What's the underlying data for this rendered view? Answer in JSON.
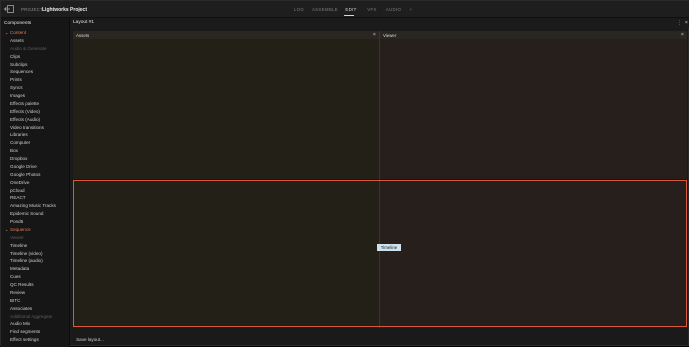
{
  "topbar": {
    "back_icon": "exit-icon",
    "project_label": "PROJECT",
    "project_name": "Lightworks Project",
    "tabs": [
      {
        "label": "LOG",
        "active": false
      },
      {
        "label": "ASSEMBLE",
        "active": false
      },
      {
        "label": "EDIT",
        "active": true
      },
      {
        "label": "VFX",
        "active": false
      },
      {
        "label": "AUDIO",
        "active": false
      },
      {
        "label": "+",
        "active": false
      }
    ]
  },
  "sidebar": {
    "title": "Components",
    "items": [
      {
        "label": "Content",
        "type": "group"
      },
      {
        "label": "Assets",
        "type": "item"
      },
      {
        "label": "Audio & Generate",
        "type": "dim"
      },
      {
        "label": "Clips",
        "type": "item"
      },
      {
        "label": "Subclips",
        "type": "item"
      },
      {
        "label": "Sequences",
        "type": "item"
      },
      {
        "label": "Prints",
        "type": "item"
      },
      {
        "label": "Syncs",
        "type": "item"
      },
      {
        "label": "Images",
        "type": "item"
      },
      {
        "label": "Effects palette",
        "type": "item"
      },
      {
        "label": "Effects (Video)",
        "type": "item"
      },
      {
        "label": "Effects (Audio)",
        "type": "item"
      },
      {
        "label": "Video transitions",
        "type": "item"
      },
      {
        "label": "Libraries",
        "type": "item"
      },
      {
        "label": "Computer",
        "type": "item"
      },
      {
        "label": "Box",
        "type": "item"
      },
      {
        "label": "Dropbox",
        "type": "item"
      },
      {
        "label": "Google Drive",
        "type": "item"
      },
      {
        "label": "Google Photos",
        "type": "item"
      },
      {
        "label": "OneDrive",
        "type": "item"
      },
      {
        "label": "pCloud",
        "type": "item"
      },
      {
        "label": "REACT",
        "type": "item"
      },
      {
        "label": "Amazing Music Tracks",
        "type": "item"
      },
      {
        "label": "Epidemic Sound",
        "type": "item"
      },
      {
        "label": "Pond5",
        "type": "item"
      },
      {
        "label": "Sequence",
        "type": "group"
      },
      {
        "label": "Viewer",
        "type": "dim"
      },
      {
        "label": "Timeline",
        "type": "item"
      },
      {
        "label": "Timeline (video)",
        "type": "item"
      },
      {
        "label": "Timeline (audio)",
        "type": "item"
      },
      {
        "label": "Metadata",
        "type": "item"
      },
      {
        "label": "Cues",
        "type": "item"
      },
      {
        "label": "QC Results",
        "type": "item"
      },
      {
        "label": "Review",
        "type": "item"
      },
      {
        "label": "BITC",
        "type": "item"
      },
      {
        "label": "Associates",
        "type": "item"
      },
      {
        "label": "Additional Aggregate",
        "type": "dim"
      },
      {
        "label": "Audio Mix",
        "type": "item"
      },
      {
        "label": "Find segments",
        "type": "item"
      },
      {
        "label": "Effect settings",
        "type": "item"
      }
    ]
  },
  "layout": {
    "title": "Layout #1",
    "menu_icon": "kebab-menu-icon",
    "close_icon": "close-icon"
  },
  "panels": {
    "assets_title": "Assets",
    "viewer_title": "Viewer",
    "timeline_label": "Timeline"
  },
  "footer": {
    "save_label": "Save layout..."
  },
  "colors": {
    "accent": "#d9573a",
    "group_label": "#ea7a52",
    "timeline_tag": "#cde2ec"
  }
}
